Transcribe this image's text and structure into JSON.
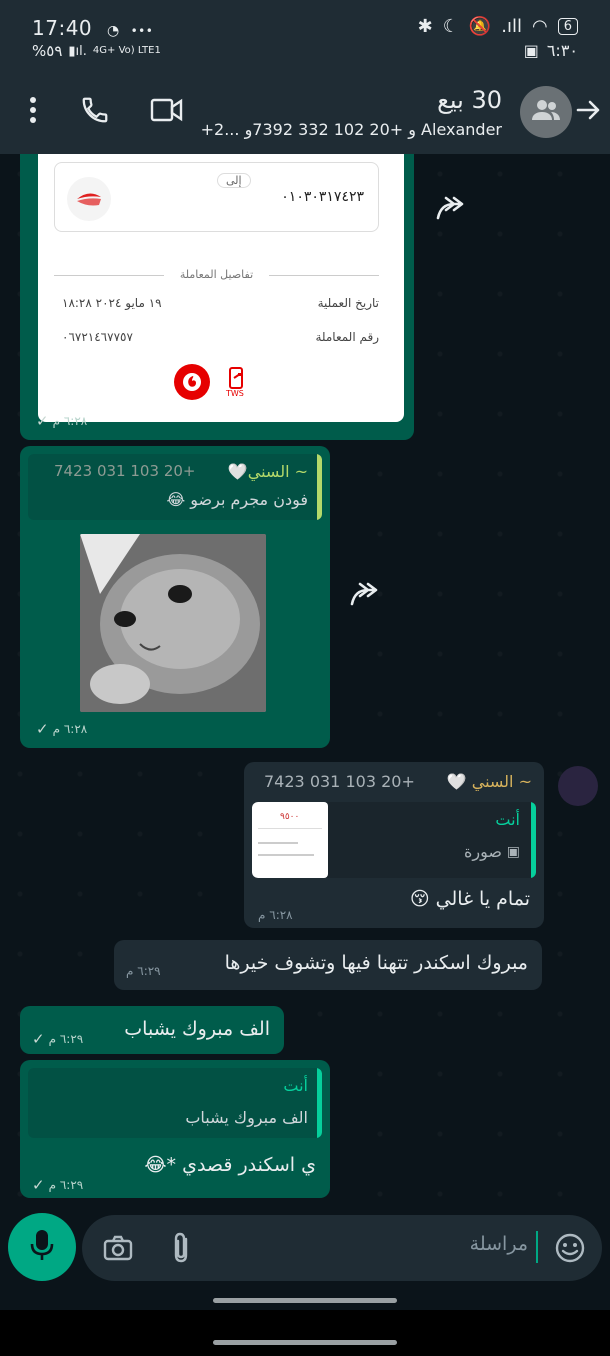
{
  "status_bar": {
    "time": "17:40",
    "dots": "•••",
    "battery_pct": "%٥٩",
    "network": "4G+ Vo) LTE1",
    "battery_right": "6",
    "clock_right": "٦:٣٠"
  },
  "header": {
    "title": "30 بيع",
    "subtitle": "+2... و +20 102 332 7392و Alexander",
    "back_icon": "arrow-right-icon",
    "avatar_icon": "group-icon"
  },
  "messages": [
    {
      "type": "forwarded_receipt",
      "to_label": "إلى",
      "account_number": "٠١٠٣٠٣١٧٤٢٣",
      "section_title": "تفاصيل المعاملة",
      "rows": [
        {
          "label": "تاريخ العملية",
          "value": "١٩ مايو ٢٠٢٤ ١٨:٢٨"
        },
        {
          "label": "رقم المعاملة",
          "value": "٠٦٧٢١٤٦٧٧٥٧"
        }
      ],
      "time": "٦:٢٨ م"
    },
    {
      "type": "quoted_image",
      "quote_name": "~ السني🤍",
      "quote_phone": "+20 103 031 7423",
      "quote_text": "فودن مجرم برضو 😂",
      "time": "٦:٢٨ م"
    },
    {
      "type": "incoming_reply",
      "quote_name": "~ السني 🤍",
      "quote_phone": "+20 103 031 7423",
      "reply_to_name": "أنت",
      "reply_to_text": "صورة",
      "thumb_amount": "٩٥٠٠",
      "text": "تمام يا غالي 😚",
      "time": "٦:٢٨ م"
    },
    {
      "type": "incoming",
      "text": "مبروك اسكندر تتهنا فيها وتشوف خيرها",
      "time": "٦:٢٩ م"
    },
    {
      "type": "outgoing",
      "text": "الف مبروك يشباب",
      "time": "٦:٢٩ م"
    },
    {
      "type": "outgoing_reply",
      "reply_to_name": "أنت",
      "reply_to_text": "الف مبروك يشباب",
      "text": "ي اسكندر قصدي *😂",
      "time": "٦:٢٩ م"
    }
  ],
  "composer": {
    "placeholder": "مراسلة"
  }
}
